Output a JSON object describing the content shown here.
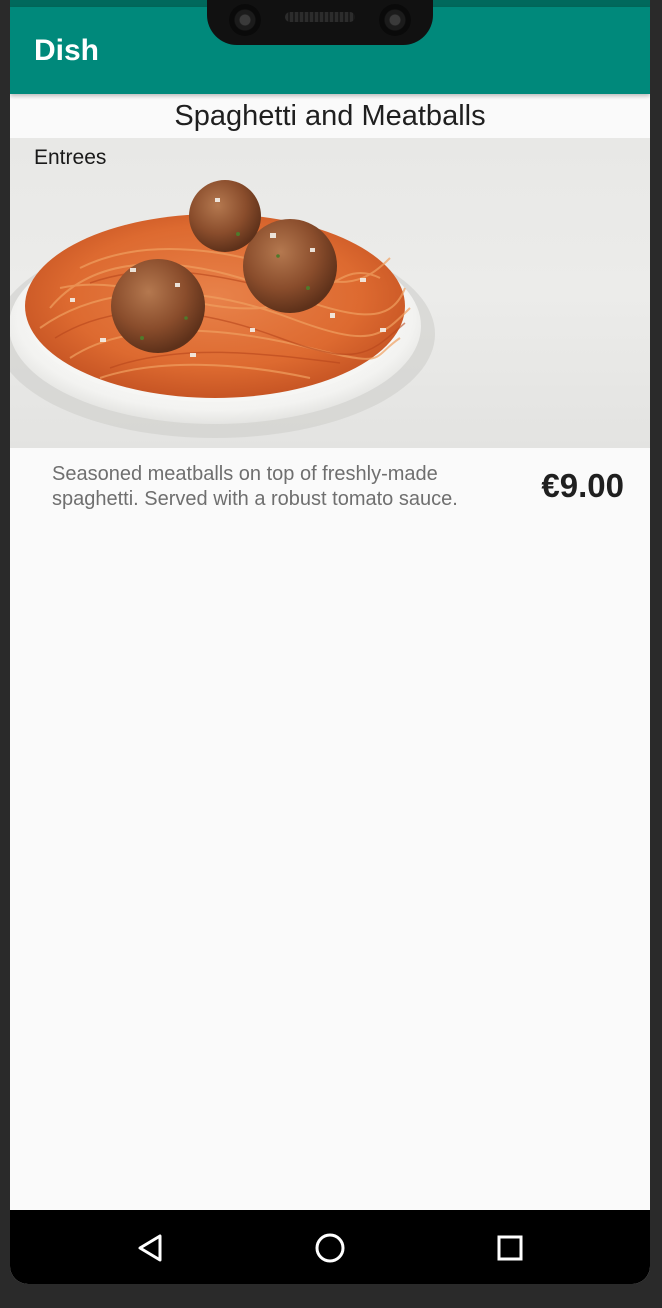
{
  "appbar": {
    "title": "Dish",
    "color": "#00897b"
  },
  "dish": {
    "name": "Spaghetti and Meatballs",
    "category": "Entrees",
    "description": "Seasoned meatballs on top of freshly-made spaghetti. Served with a robust tomato sauce.",
    "price": "€9.00",
    "image_icon": "spaghetti-meatballs-photo"
  },
  "navbar": {
    "back_icon": "back-triangle-icon",
    "home_icon": "home-circle-icon",
    "recents_icon": "recents-square-icon"
  }
}
